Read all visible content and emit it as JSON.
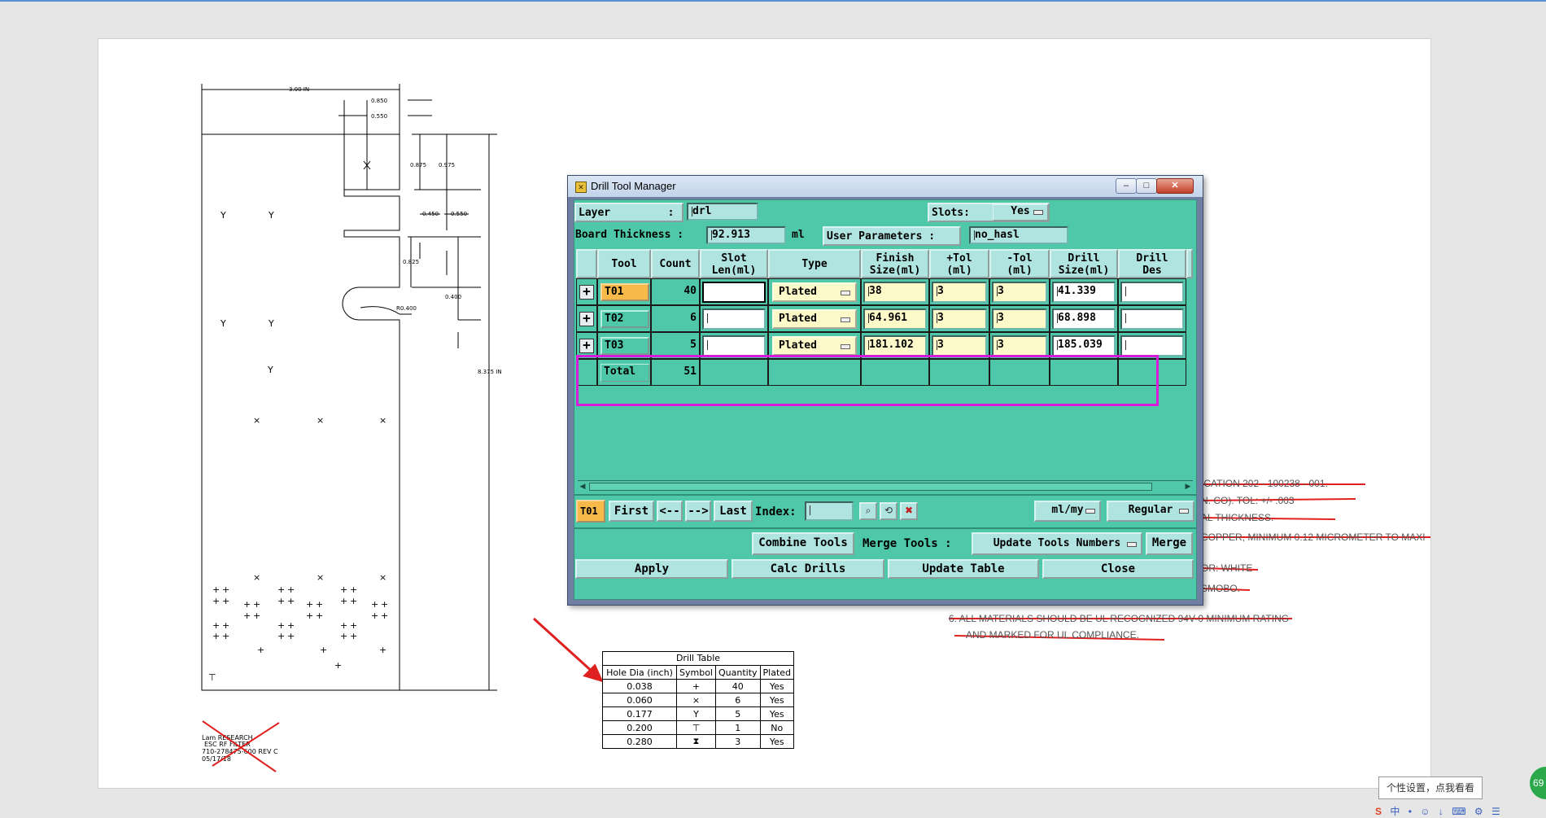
{
  "window": {
    "title": "Drill Tool Manager",
    "min": "–",
    "max": "□",
    "close": "✕"
  },
  "form": {
    "layer_label": "Layer         :",
    "layer_value": "drl",
    "slots_label": "Slots:",
    "slots_value": "Yes",
    "board_thickness_label": "Board Thickness :",
    "board_thickness_value": "92.913",
    "board_thickness_unit": "ml",
    "user_params_label": "User Parameters :",
    "user_params_value": "no_hasl"
  },
  "grid": {
    "headers": [
      {
        "l1": "",
        "l2": ""
      },
      {
        "l1": "Tool",
        "l2": ""
      },
      {
        "l1": "Count",
        "l2": ""
      },
      {
        "l1": "Slot",
        "l2": "Len(ml)"
      },
      {
        "l1": "Type",
        "l2": ""
      },
      {
        "l1": "Finish",
        "l2": "Size(ml)"
      },
      {
        "l1": "+Tol",
        "l2": "(ml)"
      },
      {
        "l1": "-Tol",
        "l2": "(ml)"
      },
      {
        "l1": "Drill",
        "l2": "Size(ml)"
      },
      {
        "l1": "Drill",
        "l2": "Des"
      }
    ],
    "rows": [
      {
        "tool": "T01",
        "count": "40",
        "slot": "",
        "type": "Plated",
        "finish": "38",
        "ptol": "3",
        "ntol": "3",
        "drill": "41.339",
        "des": ""
      },
      {
        "tool": "T02",
        "count": "6",
        "slot": "",
        "type": "Plated",
        "finish": "64.961",
        "ptol": "3",
        "ntol": "3",
        "drill": "68.898",
        "des": ""
      },
      {
        "tool": "T03",
        "count": "5",
        "slot": "",
        "type": "Plated",
        "finish": "181.102",
        "ptol": "3",
        "ntol": "3",
        "drill": "185.039",
        "des": ""
      }
    ],
    "total_label": "Total",
    "total_count": "51"
  },
  "nav": {
    "current": "T01",
    "first": "First",
    "prev": "<--",
    "next": "-->",
    "last": "Last",
    "index_label": "Index:",
    "index_value": "",
    "units": "ml/my",
    "mode": "Regular"
  },
  "tools_bar": {
    "combine": "Combine Tools",
    "merge_label": "Merge Tools :",
    "merge_option": "Update Tools Numbers",
    "merge": "Merge"
  },
  "actions": {
    "apply": "Apply",
    "calc": "Calc Drills",
    "update": "Update Table",
    "close": "Close"
  },
  "drawing": {
    "dims": {
      "width": "3.00 IN",
      "d850": "0.850",
      "d550": "0.550",
      "d875": "0.875",
      "d975": "0.975",
      "d450": "0.450",
      "d550b": "0.550",
      "d825": "0.825",
      "d400": "0.400",
      "r400": "R0.400",
      "height": "8.375 IN"
    },
    "title_block": [
      "Lam RESEARCH",
      "ESC RF FILTER",
      "710-278475-600 REV C",
      "05/17/18"
    ],
    "marks": {
      "y": "Y",
      "x": "×",
      "plus": "+",
      "t": "⊤"
    }
  },
  "drill_table": {
    "title": "Drill Table",
    "headers": [
      "Hole Dia (inch)",
      "Symbol",
      "Quantity",
      "Plated"
    ],
    "rows": [
      [
        "0.038",
        "+",
        "40",
        "Yes"
      ],
      [
        "0.060",
        "×",
        "6",
        "Yes"
      ],
      [
        "0.177",
        "Y",
        "5",
        "Yes"
      ],
      [
        "0.200",
        "⊤",
        "1",
        "No"
      ],
      [
        "0.280",
        "⧗",
        "3",
        "Yes"
      ]
    ]
  },
  "notes": [
    "ICATION 202 - 100238 - 001.",
    "N. CO). TOL: +/- .003",
    "AL THICKNESS.",
    "COPPER, MINIMUM 0.12 MICROMETER TO MAXI",
    "OR: WHITE",
    "SMOBO.",
    "6.  ALL MATERIALS SHOULD BE UL RECOGNIZED 94V-0 MINIMUM RATING",
    "AND MARKED FOR UL COMPLIANCE."
  ],
  "tray": {
    "tooltip": "个性设置，点我看看",
    "badge": "69",
    "icons": [
      "S",
      "中",
      "•",
      "☺",
      "↓",
      "⌨",
      "⚙",
      "☰"
    ]
  },
  "colors": {
    "client_bg": "#4ec8a8",
    "label_bg": "#b0e4e0",
    "field_yellow": "#fdf9c8",
    "selected_tool": "#f6b94a",
    "highlight": "#d81bd8",
    "annotation_red": "#e02020"
  }
}
